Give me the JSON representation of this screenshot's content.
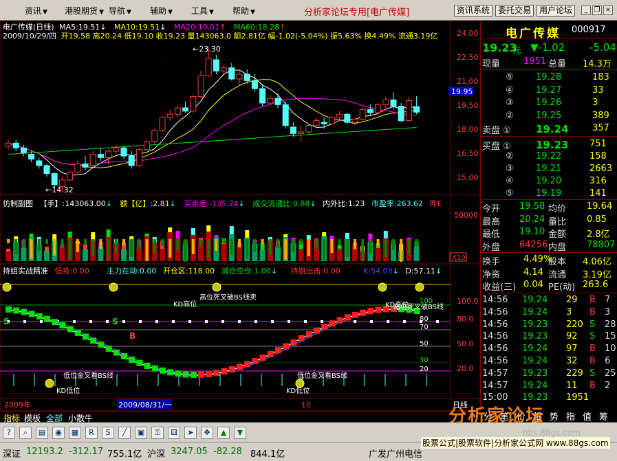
{
  "menu": {
    "items": [
      "资讯",
      "港股期货",
      "导航",
      "辅助",
      "工具",
      "帮助"
    ],
    "brand": "分析家论坛专用",
    "stock_tag": "[电广传媒]",
    "buttons": [
      "资讯系统",
      "委托交易",
      "用户论坛"
    ]
  },
  "main_chart": {
    "title": "电广传媒(日线)",
    "ma5": "MA5:19.51",
    "ma10": "MA10:19.51",
    "ma20": "MA20:19.01",
    "ma60": "MA60:18.28",
    "date": "2009/10/29/四",
    "info": "开19.58 高20.24 低19.10 收19.23 量143063.0 额2.81亿 幅-1.02(-5.04%) 振5.63% 换4.49% 流通3.19亿",
    "high_label": "23.30",
    "low_label": "14.32",
    "price_tag": "19.95",
    "y_ticks": [
      "24.00",
      "22.50",
      "21.00",
      "19.50",
      "18.00",
      "16.50",
      "15.00"
    ]
  },
  "sub1": {
    "title": "仿制副图",
    "f1": "【手】:143063.00",
    "f2": "额【亿】:2.81",
    "f3": "买卖差:-135.24",
    "f4": "成交流通比:0.88",
    "f5": "内外比:1.23",
    "f6": "市盈率:263.62",
    "f7": "昨E",
    "y_tick": "50000",
    "multiplier": "X10"
  },
  "sub2": {
    "title": "持姐实战精准",
    "f1": "低吸:0.00",
    "f2": "主力在动:0.00",
    "f3": "开仓区:118.00",
    "f4": "减仓空仓:1.00",
    "f5": "持姐出击:0.00",
    "f6": "K:54.03",
    "f7": "D:57.11",
    "y_ticks": [
      "100.0",
      "80.0",
      "50.0",
      "20.0"
    ],
    "lvl_labels": [
      "100",
      "80",
      "70",
      "50",
      "30",
      "20"
    ],
    "ann": {
      "top1": "KD高位",
      "top2": "高位死叉破BS线卖",
      "top3": "KD高位",
      "top4": "高位死叉破BS线",
      "low1": "低位金叉看BS线",
      "low2": "KD低位",
      "low3": "低位金叉看BS线",
      "low4": "KD低位",
      "b_mark": "B",
      "s_mark": "S"
    }
  },
  "date_axis": [
    "2009年",
    "2009/08/31/一",
    "10",
    "日线"
  ],
  "tabs": [
    "指标",
    "模板",
    "全部",
    "小散牛"
  ],
  "quote": {
    "name": "电广传媒",
    "code": "000917",
    "price": "19.23",
    "unit": "元",
    "change": "▼-1.02",
    "change_pct": "-5.04",
    "now_vol_label": "现量",
    "now_vol": "1951",
    "total_vol_label": "总量",
    "total_vol": "14.3万",
    "sells": [
      {
        "lvl": "⑤",
        "price": "19.28",
        "vol": "183"
      },
      {
        "lvl": "④",
        "price": "19.27",
        "vol": "33"
      },
      {
        "lvl": "③",
        "price": "19.26",
        "vol": "3"
      },
      {
        "lvl": "②",
        "price": "19.25",
        "vol": "389"
      },
      {
        "lvl": "卖盘 ①",
        "price": "19.24",
        "vol": "357"
      }
    ],
    "buys": [
      {
        "lvl": "买盘 ①",
        "price": "19.23",
        "vol": "751"
      },
      {
        "lvl": "②",
        "price": "19.22",
        "vol": "158"
      },
      {
        "lvl": "③",
        "price": "19.21",
        "vol": "2663"
      },
      {
        "lvl": "④",
        "price": "19.20",
        "vol": "316"
      },
      {
        "lvl": "⑤",
        "price": "19.19",
        "vol": "141"
      }
    ],
    "stats": [
      {
        "k1": "今开",
        "v1": "19.58",
        "k2": "均价",
        "v2": "19.64"
      },
      {
        "k1": "最高",
        "v1": "20.24",
        "k2": "量比",
        "v2": "0.85"
      },
      {
        "k1": "最低",
        "v1": "19.10",
        "k2": "金额",
        "v2": "2.8亿"
      },
      {
        "k1": "外盘",
        "v1": "64256",
        "k2": "内盘",
        "v2": "78807"
      }
    ],
    "stats2": [
      {
        "k1": "换手",
        "v1": "4.49%",
        "k2": "股本",
        "v2": "4.06亿"
      },
      {
        "k1": "净资",
        "v1": "4.14",
        "k2": "流通",
        "v2": "3.19亿"
      },
      {
        "k1": "收益(三)",
        "v1": "0.04",
        "k2": "PE(动)",
        "v2": "263.6"
      }
    ],
    "ticks": [
      {
        "t": "14:56",
        "p": "19.24",
        "v": "29",
        "d": "B",
        "n": "7"
      },
      {
        "t": "14:56",
        "p": "19.24",
        "v": "3",
        "d": "B",
        "n": "3"
      },
      {
        "t": "14:56",
        "p": "19.23",
        "v": "220",
        "d": "S",
        "n": "28"
      },
      {
        "t": "14:56",
        "p": "19.23",
        "v": "92",
        "d": "S",
        "n": "15"
      },
      {
        "t": "14:56",
        "p": "19.24",
        "v": "97",
        "d": "B",
        "n": "10"
      },
      {
        "t": "14:56",
        "p": "19.24",
        "v": "32",
        "d": "B",
        "n": "6"
      },
      {
        "t": "14:57",
        "p": "19.23",
        "v": "229",
        "d": "S",
        "n": "25"
      },
      {
        "t": "14:57",
        "p": "19.24",
        "v": "11",
        "d": "B",
        "n": "2"
      },
      {
        "t": "15:00",
        "p": "19.23",
        "v": "1951",
        "d": "",
        "n": ""
      }
    ],
    "bottom_tabs": [
      "分",
      "笔",
      "价",
      "细",
      "势",
      "指",
      "值",
      "筹"
    ]
  },
  "toolbar_icons": [
    "help-icon",
    "zoom-icon",
    "chart-icon",
    "eye-icon",
    "table-icon",
    "rsi-icon",
    "sql-icon",
    "line-icon",
    "cal-icon",
    "lock-icon",
    "dice-icon",
    "arrow-icon",
    "move-icon",
    "up-icon",
    "down-icon"
  ],
  "status": {
    "sz_label": "深证",
    "sz_value": "12193.2",
    "sz_change": "-312.17",
    "sz_amount": "755.1亿",
    "hs_label": "沪深",
    "hs_value": "3247.05",
    "hs_change": "-82.28",
    "hs_amount": "844.1亿",
    "broker": "广发广州电信",
    "ad": "股票公式|股票软件|分析家公式网 www.88gs.com"
  },
  "watermark": {
    "text": "分析家论坛",
    "url": "bbs.88gs.com"
  },
  "colors": {
    "up": "#ff3c3c",
    "down": "#54ffff",
    "green": "#00e000",
    "yellow": "#ffff00",
    "magenta": "#ff00ff",
    "frame": "#800000"
  },
  "chart_data": {
    "type": "candlestick",
    "candles": [
      [
        17.1,
        17.5,
        16.9,
        17.3
      ],
      [
        17.3,
        17.5,
        16.8,
        17.0
      ],
      [
        17.0,
        17.2,
        16.5,
        16.7
      ],
      [
        16.6,
        16.8,
        16.1,
        16.3
      ],
      [
        16.2,
        16.4,
        15.7,
        15.9
      ],
      [
        15.9,
        16.0,
        15.2,
        15.4
      ],
      [
        15.4,
        15.5,
        14.5,
        14.7
      ],
      [
        14.6,
        15.2,
        14.32,
        15.0
      ],
      [
        15.0,
        15.6,
        14.9,
        15.5
      ],
      [
        15.5,
        16.2,
        15.4,
        16.0
      ],
      [
        16.0,
        16.5,
        15.6,
        15.8
      ],
      [
        15.9,
        16.8,
        15.8,
        16.6
      ],
      [
        16.6,
        17.0,
        16.2,
        16.4
      ],
      [
        16.4,
        16.9,
        16.0,
        16.8
      ],
      [
        16.8,
        17.2,
        16.6,
        17.0
      ],
      [
        17.0,
        17.1,
        16.3,
        16.5
      ],
      [
        16.5,
        16.8,
        15.7,
        15.9
      ],
      [
        15.9,
        17.0,
        15.8,
        16.9
      ],
      [
        16.9,
        17.5,
        16.8,
        17.4
      ],
      [
        17.4,
        18.2,
        17.3,
        18.1
      ],
      [
        18.1,
        19.0,
        18.0,
        18.9
      ],
      [
        18.9,
        19.4,
        18.7,
        19.1
      ],
      [
        19.1,
        19.6,
        18.9,
        19.5
      ],
      [
        19.5,
        19.9,
        19.2,
        19.3
      ],
      [
        19.3,
        20.3,
        19.2,
        20.2
      ],
      [
        20.2,
        21.8,
        20.1,
        21.5
      ],
      [
        21.5,
        23.3,
        21.4,
        22.6
      ],
      [
        22.5,
        22.8,
        21.6,
        21.8
      ],
      [
        21.8,
        22.2,
        21.5,
        22.0
      ],
      [
        22.0,
        22.3,
        21.2,
        21.3
      ],
      [
        21.3,
        21.8,
        20.9,
        21.6
      ],
      [
        21.6,
        21.9,
        21.0,
        21.2
      ],
      [
        21.2,
        21.6,
        20.5,
        20.7
      ],
      [
        20.7,
        20.9,
        19.6,
        19.8
      ],
      [
        19.8,
        20.3,
        19.6,
        20.1
      ],
      [
        20.1,
        20.4,
        19.5,
        19.7
      ],
      [
        19.7,
        19.9,
        18.2,
        18.4
      ],
      [
        18.3,
        18.6,
        17.7,
        17.9
      ],
      [
        17.9,
        18.4,
        17.4,
        18.0
      ],
      [
        18.0,
        18.5,
        17.8,
        18.4
      ],
      [
        18.4,
        18.9,
        18.2,
        18.7
      ],
      [
        18.6,
        18.9,
        18.2,
        18.5
      ],
      [
        18.5,
        19.0,
        18.4,
        18.9
      ],
      [
        18.9,
        19.3,
        18.7,
        19.1
      ],
      [
        19.1,
        19.2,
        18.5,
        18.6
      ],
      [
        18.6,
        18.9,
        18.4,
        18.8
      ],
      [
        18.8,
        19.5,
        18.7,
        19.4
      ],
      [
        19.4,
        19.7,
        19.0,
        19.2
      ],
      [
        19.2,
        19.8,
        19.1,
        19.7
      ],
      [
        19.7,
        20.2,
        19.5,
        20.0
      ],
      [
        20.0,
        20.5,
        19.4,
        19.6
      ],
      [
        19.6,
        19.8,
        18.6,
        18.7
      ],
      [
        18.7,
        20.2,
        18.6,
        19.95
      ],
      [
        19.58,
        20.24,
        19.1,
        19.23
      ]
    ]
  }
}
